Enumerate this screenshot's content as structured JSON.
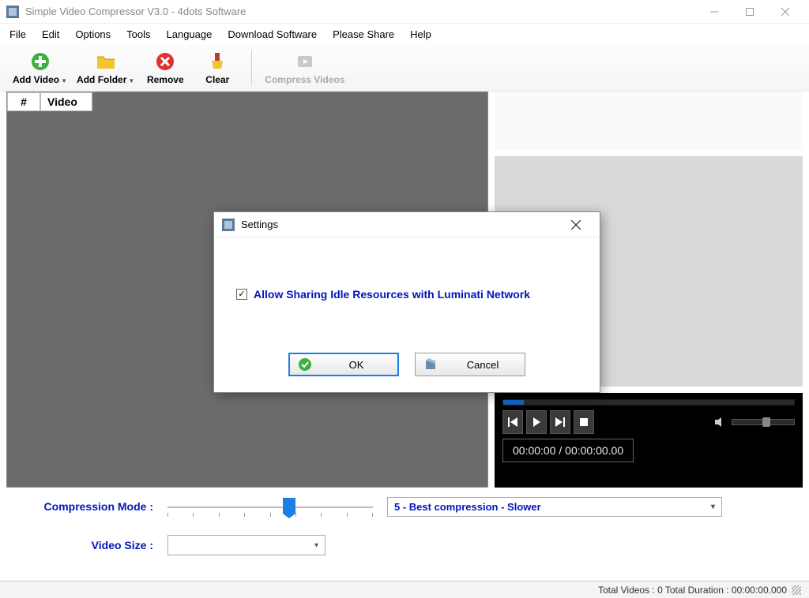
{
  "titlebar": {
    "title": "Simple Video Compressor V3.0 - 4dots Software"
  },
  "menubar": [
    "File",
    "Edit",
    "Options",
    "Tools",
    "Language",
    "Download Software",
    "Please Share",
    "Help"
  ],
  "toolbar": {
    "add_video": "Add Video",
    "add_folder": "Add Folder",
    "remove": "Remove",
    "clear": "Clear",
    "compress": "Compress Videos"
  },
  "grid": {
    "col_num": "#",
    "col_video": "Video"
  },
  "player": {
    "time": "00:00:00 / 00:00:00.00"
  },
  "controls": {
    "compression_mode_label": "Compression Mode :",
    "compression_mode_value": "5 - Best compression - Slower",
    "video_size_label": "Video Size :",
    "video_size_value": ""
  },
  "statusbar": {
    "text": "Total Videos : 0  Total Duration : 00:00:00.000"
  },
  "dialog": {
    "title": "Settings",
    "checkbox_label": "Allow Sharing Idle Resources with Luminati Network",
    "checkbox_checked": true,
    "ok": "OK",
    "cancel": "Cancel"
  }
}
